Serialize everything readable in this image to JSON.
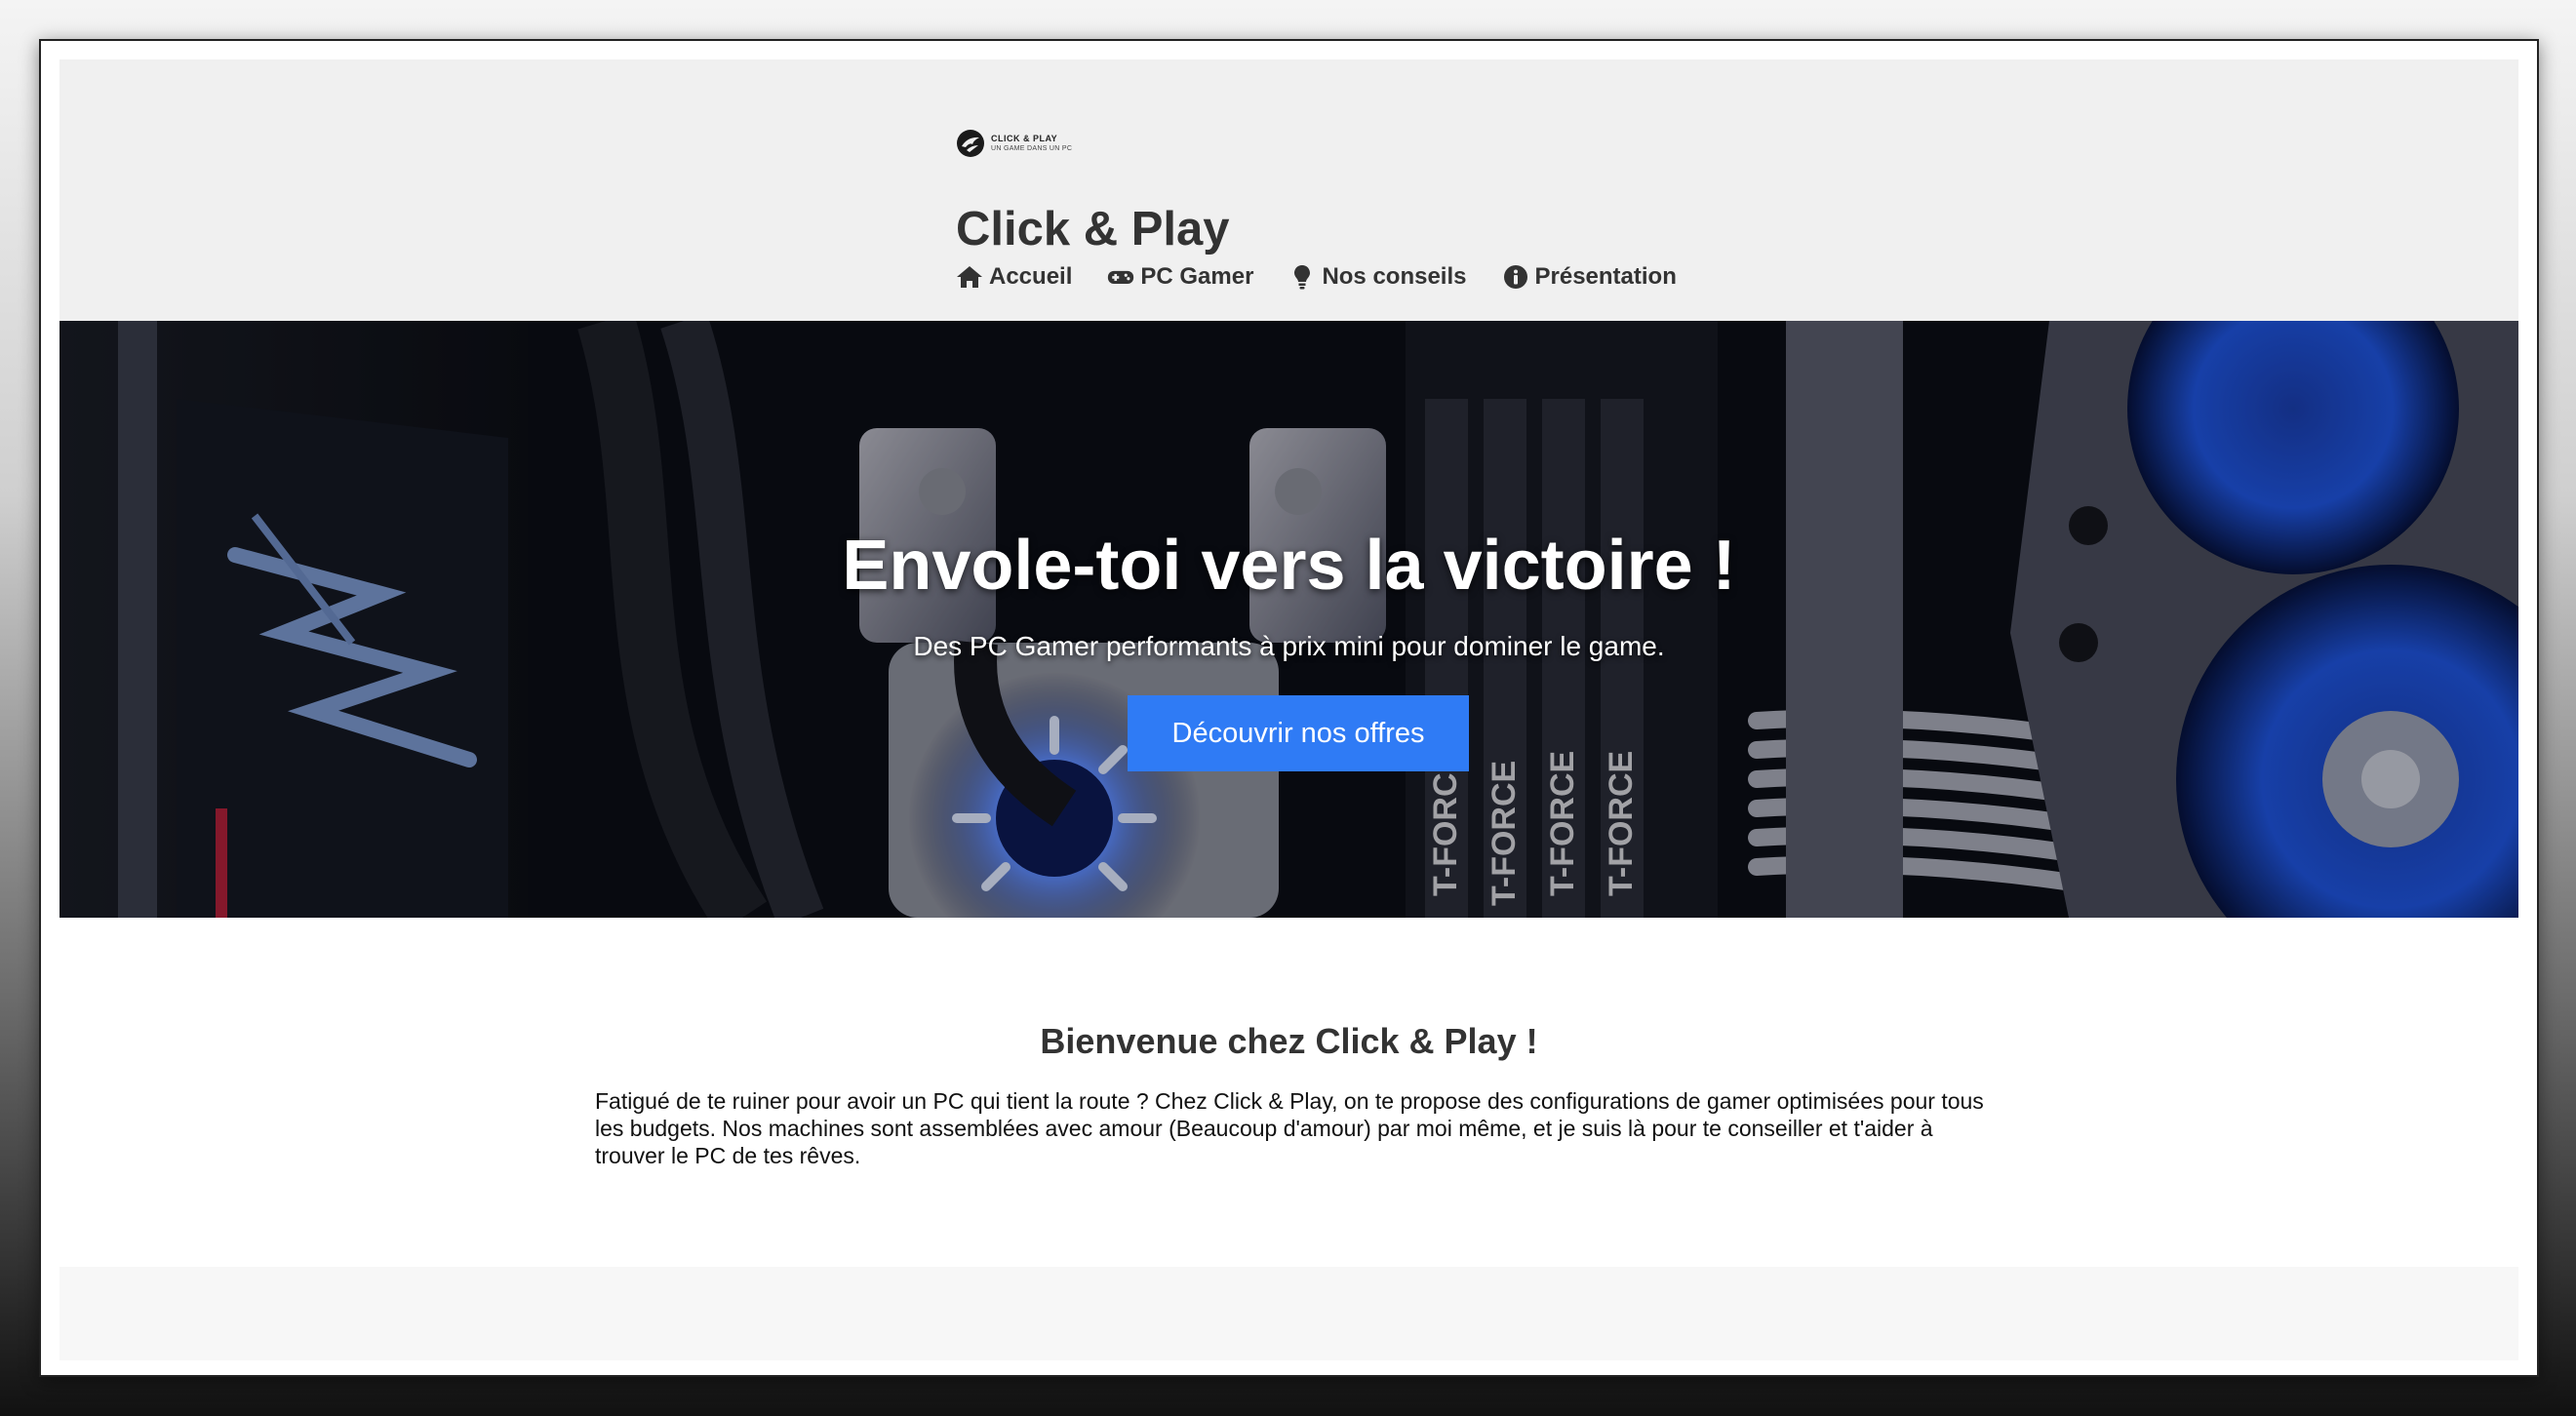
{
  "logo": {
    "name": "CLICK & PLAY",
    "tagline": "UN GAME DANS UN PC"
  },
  "header": {
    "title": "Click & Play"
  },
  "nav": {
    "items": [
      {
        "label": "Accueil",
        "icon": "home-icon"
      },
      {
        "label": "PC Gamer",
        "icon": "gamepad-icon"
      },
      {
        "label": "Nos conseils",
        "icon": "lightbulb-icon"
      },
      {
        "label": "Présentation",
        "icon": "info-icon"
      }
    ]
  },
  "hero": {
    "title": "Envole-toi vers la victoire !",
    "subtitle": "Des PC Gamer performants à prix mini pour dominer le game.",
    "cta_label": "Découvrir nos offres",
    "ram_labels": [
      "T-FORCE",
      "T-FORCE",
      "T-FORCE",
      "T-FORCE"
    ]
  },
  "main": {
    "welcome_title": "Bienvenue chez Click & Play !",
    "intro_text": "Fatigué de te ruiner pour avoir un PC qui tient la route ? Chez Click & Play, on te propose des configurations de gamer optimisées pour tous les budgets. Nos machines sont assemblées avec amour (Beaucoup d'amour) par moi même, et je suis là pour te conseiller et t'aider à trouver le PC de tes rêves."
  },
  "colors": {
    "header_bg": "#f0f0f0",
    "accent_button": "#2f7bf5",
    "text_dark": "#333333",
    "footer_bg": "#f7f7f7"
  }
}
